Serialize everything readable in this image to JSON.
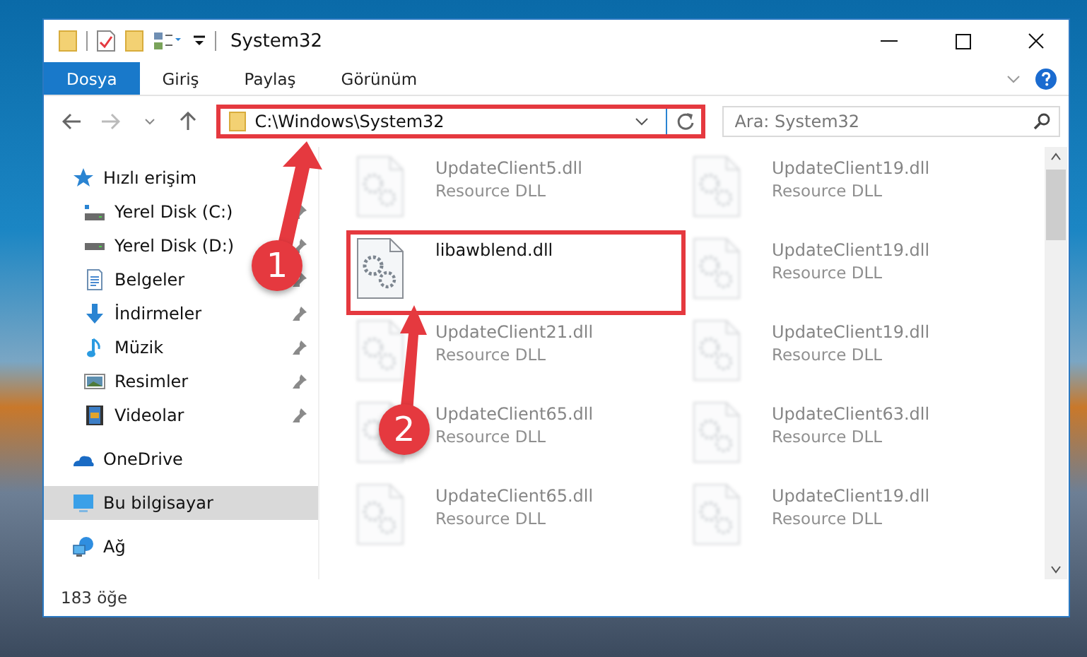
{
  "window": {
    "title": "System32"
  },
  "ribbon_tabs": [
    {
      "label": "Dosya",
      "selected": true
    },
    {
      "label": "Giriş",
      "selected": false
    },
    {
      "label": "Paylaş",
      "selected": false
    },
    {
      "label": "Görünüm",
      "selected": false
    }
  ],
  "address_bar": {
    "path": "C:\\Windows\\System32",
    "highlighted": true
  },
  "search": {
    "placeholder": "Ara: System32"
  },
  "sidebar": {
    "items": [
      {
        "label": "Hızlı erişim",
        "kind": "star",
        "selected": false,
        "children": [
          {
            "label": "Yerel Disk (C:)",
            "kind": "systemdrive",
            "pinned": true,
            "selected": false
          },
          {
            "label": "Yerel Disk (D:)",
            "kind": "drive",
            "pinned": true,
            "selected": false
          },
          {
            "label": "Belgeler",
            "kind": "document",
            "pinned": true,
            "selected": false
          },
          {
            "label": "İndirmeler",
            "kind": "download",
            "pinned": true,
            "selected": false
          },
          {
            "label": "Müzik",
            "kind": "music",
            "pinned": true,
            "selected": false
          },
          {
            "label": "Resimler",
            "kind": "picture",
            "pinned": true,
            "selected": false
          },
          {
            "label": "Videolar",
            "kind": "video",
            "pinned": true,
            "selected": false
          }
        ]
      },
      {
        "label": "OneDrive",
        "kind": "cloud",
        "selected": false
      },
      {
        "label": "Bu bilgisayar",
        "kind": "computer",
        "selected": true
      },
      {
        "label": "Ağ",
        "kind": "network",
        "selected": false
      }
    ]
  },
  "files": [
    {
      "name": "UpdateClient5.dll",
      "type": "Resource DLL",
      "blurred": true,
      "highlighted": false
    },
    {
      "name": "UpdateClient19.dll",
      "type": "Resource DLL",
      "blurred": true,
      "highlighted": false
    },
    {
      "name": "libawblend.dll",
      "blurred": false,
      "highlighted": true
    },
    {
      "name": "UpdateClient19.dll",
      "type": "Resource DLL",
      "blurred": true,
      "highlighted": false
    },
    {
      "name": "UpdateClient21.dll",
      "type": "Resource DLL",
      "blurred": true,
      "highlighted": false
    },
    {
      "name": "UpdateClient19.dll",
      "type": "Resource DLL",
      "blurred": true,
      "highlighted": false
    },
    {
      "name": "UpdateClient65.dll",
      "type": "Resource DLL",
      "blurred": true,
      "highlighted": false
    },
    {
      "name": "UpdateClient63.dll",
      "type": "Resource DLL",
      "blurred": true,
      "highlighted": false
    },
    {
      "name": "UpdateClient65.dll",
      "type": "Resource DLL",
      "blurred": true,
      "highlighted": false
    },
    {
      "name": "UpdateClient19.dll",
      "type": "Resource DLL",
      "blurred": true,
      "highlighted": false
    }
  ],
  "status_bar": {
    "count": "183 öğe"
  },
  "annotations": [
    {
      "number": "1"
    },
    {
      "number": "2"
    }
  ]
}
